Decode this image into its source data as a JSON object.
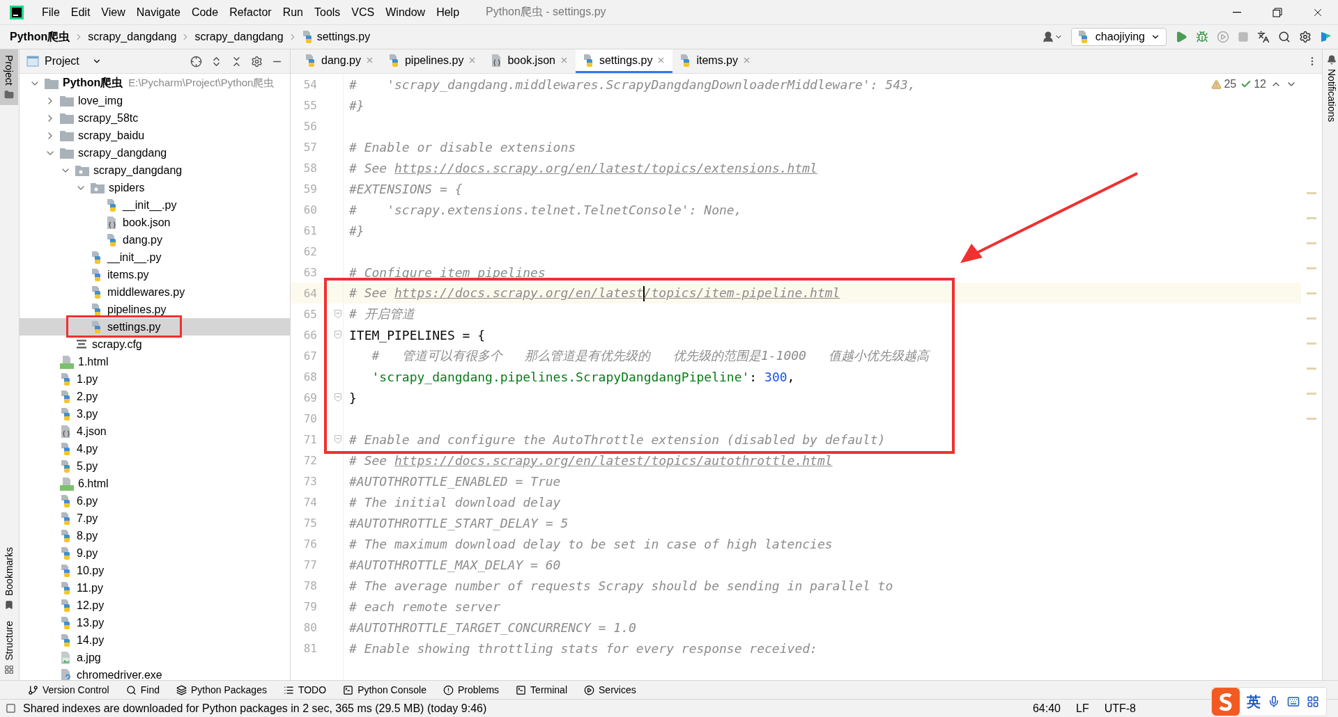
{
  "window": {
    "title": "Python爬虫 - settings.py"
  },
  "menu": [
    "File",
    "Edit",
    "View",
    "Navigate",
    "Code",
    "Refactor",
    "Run",
    "Tools",
    "VCS",
    "Window",
    "Help"
  ],
  "breadcrumbs": [
    {
      "label": "Python爬虫",
      "kind": "project"
    },
    {
      "label": "scrapy_dangdang",
      "kind": "folder"
    },
    {
      "label": "scrapy_dangdang",
      "kind": "folder"
    },
    {
      "label": "settings.py",
      "kind": "py"
    }
  ],
  "run_config": {
    "label": "chaojiying"
  },
  "left_stripe": [
    {
      "label": "Project",
      "selected": true
    },
    {
      "label": "Bookmarks",
      "selected": false
    },
    {
      "label": "Structure",
      "selected": false
    }
  ],
  "project_panel": {
    "title": "Project",
    "tree": [
      {
        "label": "Python爬虫",
        "path": "E:\\Pycharm\\Project\\Python爬虫",
        "kind": "project",
        "expanded": true,
        "selected": false,
        "children": [
          {
            "label": "love_img",
            "kind": "folder",
            "expanded": false,
            "selected": false
          },
          {
            "label": "scrapy_58tc",
            "kind": "folder",
            "expanded": false,
            "selected": false
          },
          {
            "label": "scrapy_baidu",
            "kind": "folder",
            "expanded": false,
            "selected": false
          },
          {
            "label": "scrapy_dangdang",
            "kind": "folder",
            "expanded": true,
            "selected": false,
            "children": [
              {
                "label": "scrapy_dangdang",
                "kind": "package",
                "expanded": true,
                "selected": false,
                "children": [
                  {
                    "label": "spiders",
                    "kind": "package",
                    "expanded": true,
                    "selected": false,
                    "children": [
                      {
                        "label": "__init__.py",
                        "kind": "py",
                        "selected": false
                      },
                      {
                        "label": "book.json",
                        "kind": "json",
                        "selected": false
                      },
                      {
                        "label": "dang.py",
                        "kind": "py",
                        "selected": false
                      }
                    ]
                  },
                  {
                    "label": "__init__.py",
                    "kind": "py",
                    "selected": false
                  },
                  {
                    "label": "items.py",
                    "kind": "py",
                    "selected": false
                  },
                  {
                    "label": "middlewares.py",
                    "kind": "py",
                    "selected": false
                  },
                  {
                    "label": "pipelines.py",
                    "kind": "py",
                    "selected": false
                  },
                  {
                    "label": "settings.py",
                    "kind": "py",
                    "selected": true
                  }
                ]
              },
              {
                "label": "scrapy.cfg",
                "kind": "cfg",
                "selected": false
              }
            ]
          },
          {
            "label": "1.html",
            "kind": "html",
            "selected": false
          },
          {
            "label": "1.py",
            "kind": "py",
            "selected": false
          },
          {
            "label": "2.py",
            "kind": "py",
            "selected": false
          },
          {
            "label": "3.py",
            "kind": "py",
            "selected": false
          },
          {
            "label": "4.json",
            "kind": "json",
            "selected": false
          },
          {
            "label": "4.py",
            "kind": "py",
            "selected": false
          },
          {
            "label": "5.py",
            "kind": "py",
            "selected": false
          },
          {
            "label": "6.html",
            "kind": "html",
            "selected": false
          },
          {
            "label": "6.py",
            "kind": "py",
            "selected": false
          },
          {
            "label": "7.py",
            "kind": "py",
            "selected": false
          },
          {
            "label": "8.py",
            "kind": "py",
            "selected": false
          },
          {
            "label": "9.py",
            "kind": "py",
            "selected": false
          },
          {
            "label": "10.py",
            "kind": "py",
            "selected": false
          },
          {
            "label": "11.py",
            "kind": "py",
            "selected": false
          },
          {
            "label": "12.py",
            "kind": "py",
            "selected": false
          },
          {
            "label": "13.py",
            "kind": "py",
            "selected": false
          },
          {
            "label": "14.py",
            "kind": "py",
            "selected": false
          },
          {
            "label": "a.jpg",
            "kind": "jpg",
            "selected": false
          },
          {
            "label": "chromedriver.exe",
            "kind": "exe",
            "selected": false
          }
        ]
      }
    ]
  },
  "editor": {
    "tabs": [
      {
        "label": "dang.py",
        "kind": "py",
        "selected": false
      },
      {
        "label": "pipelines.py",
        "kind": "py",
        "selected": false
      },
      {
        "label": "book.json",
        "kind": "json",
        "selected": false
      },
      {
        "label": "settings.py",
        "kind": "py",
        "selected": true
      },
      {
        "label": "items.py",
        "kind": "py",
        "selected": false
      }
    ],
    "inspections": {
      "warnings": "25",
      "passed": "12"
    },
    "lines": [
      {
        "number": "54",
        "current": false,
        "segments": [
          {
            "kind": "comment",
            "text": "#    'scrapy_dangdang.middlewares.ScrapyDangdangDownloaderMiddleware': 543,"
          }
        ]
      },
      {
        "number": "55",
        "current": false,
        "segments": [
          {
            "kind": "comment",
            "text": "#}"
          }
        ]
      },
      {
        "number": "56",
        "current": false
      },
      {
        "number": "57",
        "current": false,
        "segments": [
          {
            "kind": "comment",
            "text": "# Enable or disable extensions"
          }
        ]
      },
      {
        "number": "58",
        "current": false,
        "segments": [
          {
            "kind": "comment",
            "text": "# See "
          },
          {
            "kind": "link",
            "text": "https://docs.scrapy.org/en/latest/topics/extensions.html"
          }
        ]
      },
      {
        "number": "59",
        "current": false,
        "segments": [
          {
            "kind": "comment",
            "text": "#EXTENSIONS = {"
          }
        ]
      },
      {
        "number": "60",
        "current": false,
        "segments": [
          {
            "kind": "comment",
            "text": "#    'scrapy.extensions.telnet.TelnetConsole': None,"
          }
        ]
      },
      {
        "number": "61",
        "current": false,
        "segments": [
          {
            "kind": "comment",
            "text": "#}"
          }
        ]
      },
      {
        "number": "62",
        "current": false
      },
      {
        "number": "63",
        "current": false,
        "segments": [
          {
            "kind": "comment",
            "text": "# Configure item pipelines"
          }
        ]
      },
      {
        "number": "64",
        "current": true,
        "segments": [
          {
            "kind": "comment",
            "text": "# See "
          },
          {
            "kind": "link",
            "text": "https://docs.scrapy.org/en/latest"
          },
          {
            "kind": "caret"
          },
          {
            "kind": "link",
            "text": "/topics/item-pipeline.html"
          }
        ]
      },
      {
        "number": "65",
        "current": false,
        "fold": true,
        "segments": [
          {
            "kind": "comment",
            "text": "# 开启管道"
          }
        ]
      },
      {
        "number": "66",
        "current": false,
        "fold": true,
        "segments": [
          {
            "kind": "code",
            "text": "ITEM_PIPELINES = {"
          }
        ]
      },
      {
        "number": "67",
        "current": false,
        "segments": [
          {
            "kind": "comment",
            "text": "   #   管道可以有很多个   那么管道是有优先级的   优先级的范围是1-1000   值越小优先级越高"
          }
        ]
      },
      {
        "number": "68",
        "current": false,
        "segments": [
          {
            "kind": "string",
            "text": "   'scrapy_dangdang.pipelines.ScrapyDangdangPipeline'"
          },
          {
            "kind": "code",
            "text": ": "
          },
          {
            "kind": "number",
            "text": "300"
          },
          {
            "kind": "code",
            "text": ","
          }
        ]
      },
      {
        "number": "69",
        "current": false,
        "fold": true,
        "segments": [
          {
            "kind": "code",
            "text": "}"
          }
        ]
      },
      {
        "number": "70",
        "current": false
      },
      {
        "number": "71",
        "current": false,
        "fold": true,
        "segments": [
          {
            "kind": "comment",
            "text": "# Enable and configure the AutoThrottle extension (disabled by default)"
          }
        ]
      },
      {
        "number": "72",
        "current": false,
        "segments": [
          {
            "kind": "comment",
            "text": "# See "
          },
          {
            "kind": "link",
            "text": "https://docs.scrapy.org/en/latest/topics/autothrottle.html"
          }
        ]
      },
      {
        "number": "73",
        "current": false,
        "segments": [
          {
            "kind": "comment",
            "text": "#AUTOTHROTTLE_ENABLED = True"
          }
        ]
      },
      {
        "number": "74",
        "current": false,
        "segments": [
          {
            "kind": "comment",
            "text": "# The initial download delay"
          }
        ]
      },
      {
        "number": "75",
        "current": false,
        "segments": [
          {
            "kind": "comment",
            "text": "#AUTOTHROTTLE_START_DELAY = 5"
          }
        ]
      },
      {
        "number": "76",
        "current": false,
        "segments": [
          {
            "kind": "comment",
            "text": "# The maximum download delay to be set in case of high latencies"
          }
        ]
      },
      {
        "number": "77",
        "current": false,
        "segments": [
          {
            "kind": "comment",
            "text": "#AUTOTHROTTLE_MAX_DELAY = 60"
          }
        ]
      },
      {
        "number": "78",
        "current": false,
        "segments": [
          {
            "kind": "comment",
            "text": "# The average number of requests Scrapy should be sending in parallel to"
          }
        ]
      },
      {
        "number": "79",
        "current": false,
        "segments": [
          {
            "kind": "comment",
            "text": "# each remote server"
          }
        ]
      },
      {
        "number": "80",
        "current": false,
        "segments": [
          {
            "kind": "comment",
            "text": "#AUTOTHROTTLE_TARGET_CONCURRENCY = 1.0"
          }
        ]
      },
      {
        "number": "81",
        "current": false,
        "segments": [
          {
            "kind": "comment",
            "text": "# Enable showing throttling stats for every response received:"
          }
        ]
      }
    ]
  },
  "right_stripe": [
    {
      "label": "Notifications"
    }
  ],
  "bottom_tools": [
    {
      "label": "Version Control",
      "kind": "vcs"
    },
    {
      "label": "Find",
      "kind": "find"
    },
    {
      "label": "Python Packages",
      "kind": "packages"
    },
    {
      "label": "TODO",
      "kind": "todo"
    },
    {
      "label": "Python Console",
      "kind": "console"
    },
    {
      "label": "Problems",
      "kind": "problems"
    },
    {
      "label": "Terminal",
      "kind": "terminal"
    },
    {
      "label": "Services",
      "kind": "services"
    }
  ],
  "status_bar": {
    "message": "Shared indexes are downloaded for Python packages in 2 sec, 365 ms (29.5 MB) (today 9:46)",
    "position": "64:40",
    "line_separator": "LF",
    "encoding": "UTF-8"
  },
  "ime": {
    "mode": "英"
  },
  "annotations": [
    {
      "kind": "box"
    },
    {
      "kind": "box"
    },
    {
      "kind": "arrow"
    }
  ]
}
